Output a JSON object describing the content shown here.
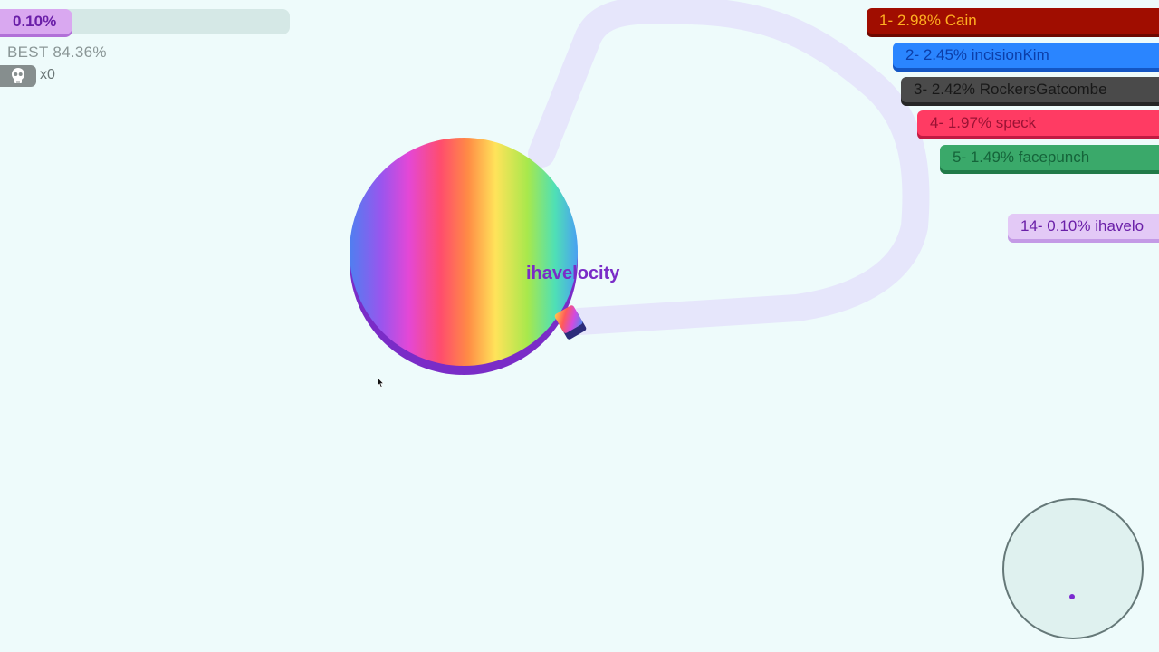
{
  "hud": {
    "score": "0.10%",
    "score_fraction": 0.001,
    "best": "BEST 84.36%",
    "kills_icon": "skull-icon",
    "kills": "x0"
  },
  "leaderboard": [
    {
      "text": "1- 2.98% Cain"
    },
    {
      "text": "2- 2.45% incisionKim"
    },
    {
      "text": "3- 2.42% RockersGatcombe"
    },
    {
      "text": "4- 1.97% speck"
    },
    {
      "text": "5- 1.49% facepunch"
    },
    {
      "text": "14- 0.10% ihavelo"
    }
  ],
  "player": {
    "name": "ihavelocity",
    "skin": "rainbow"
  },
  "colors": {
    "background": "#eefbfb",
    "trail": "#e6e6fb",
    "player_accent": "#7a2cc7"
  },
  "controls": {
    "joystick_icon": "joystick-icon"
  }
}
